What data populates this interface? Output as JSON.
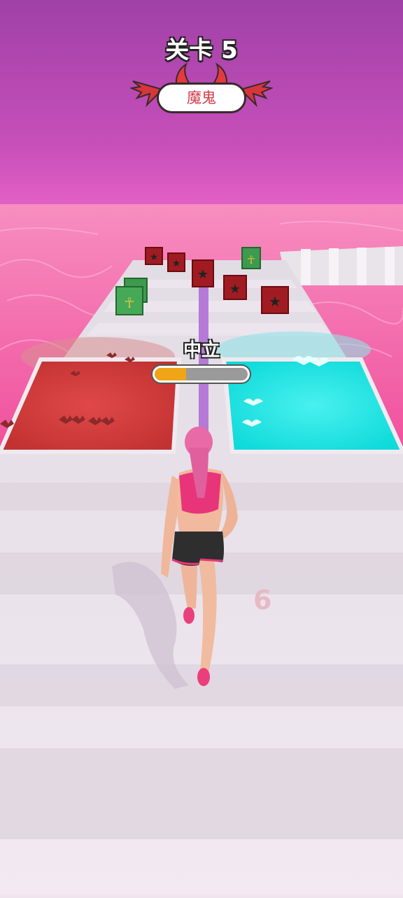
{
  "hud": {
    "level_label": "关卡 5",
    "badge_label": "魔鬼",
    "status_label": "中立",
    "progress": 0.34
  },
  "scene": {
    "gate_count": "6",
    "colors": {
      "sky_top": "#a142a8",
      "sky_bottom": "#e061c4",
      "water": "#f45aa4",
      "devil_gate": "#d23a3a",
      "angel_gate": "#18e6e6",
      "progress_fill": "#f0a417",
      "runner_top": "#e8357a"
    },
    "icons": [
      "devil-horn-icon",
      "bat-wing-icon",
      "pentagram-icon",
      "ankh-icon"
    ]
  }
}
